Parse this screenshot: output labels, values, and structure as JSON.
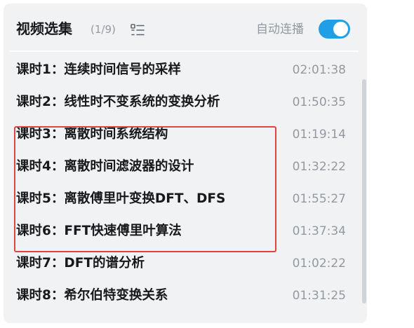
{
  "header": {
    "title": "视频选集",
    "count": "(1/9)",
    "list_mode_icon": "list-view-icon",
    "autoplay_label": "自动连播",
    "autoplay_on": true
  },
  "episodes": [
    {
      "title": "课时1：连续时间信号的采样",
      "duration": "02:01:38"
    },
    {
      "title": "课时2：线性时不变系统的变换分析",
      "duration": "01:50:35"
    },
    {
      "title": "课时3：离散时间系统结构",
      "duration": "01:19:14"
    },
    {
      "title": "课时4：离散时间滤波器的设计",
      "duration": "01:32:22"
    },
    {
      "title": "课时5：离散傅里叶变换DFT、DFS",
      "duration": "01:55:27"
    },
    {
      "title": "课时6：FFT快速傅里叶算法",
      "duration": "01:37:34"
    },
    {
      "title": "课时7：DFT的谱分析",
      "duration": "01:02:22"
    },
    {
      "title": "课时8：希尔伯特变换关系",
      "duration": "01:31:25"
    }
  ],
  "colors": {
    "panel_bg": "#f1f2f3",
    "toggle_on": "#1e9fe7",
    "highlight": "#e3433f",
    "text_primary": "#18191c",
    "text_secondary": "#9499a0"
  }
}
